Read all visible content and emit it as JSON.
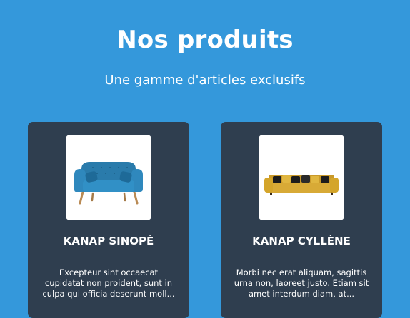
{
  "header": {
    "title": "Nos produits",
    "subtitle": "Une gamme d'articles exclusifs"
  },
  "products": [
    {
      "name": "KANAP SINOPÉ",
      "description": "Excepteur sint occaecat cupidatat non proident, sunt in culpa qui officia deserunt moll...",
      "image_icon": "blue-sofa-image",
      "color": "#2a7bab"
    },
    {
      "name": "KANAP CYLLÈNE",
      "description": "Morbi nec erat aliquam, sagittis urna non, laoreet justo. Etiam sit amet interdum diam, at...",
      "image_icon": "yellow-sofa-image",
      "color": "#d4a52a"
    }
  ],
  "colors": {
    "background": "#3498db",
    "card": "#2f3e4f"
  }
}
